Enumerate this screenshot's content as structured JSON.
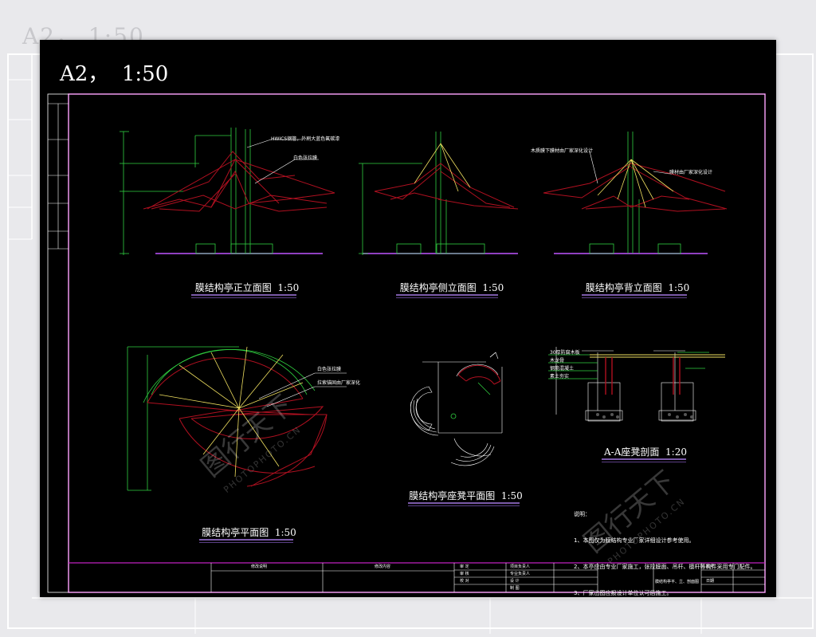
{
  "sheet_title": "A2，  1:50",
  "background_title": "A2，  1:50",
  "views": {
    "front_elevation": "膜结构亭正立面图  1:50",
    "side_elevation": "膜结构亭侧立面图  1:50",
    "back_elevation": "膜结构亭背立面图  1:50",
    "plan": "膜结构亭平面图  1:50",
    "seat_plan": "膜结构亭座凳平面图  1:50",
    "seat_section": "A-A座凳剖面  1:20"
  },
  "annotations": {
    "front_1": "HWICS钢管，外刷大蓝色氟碳漆",
    "front_2": "白色张拉膜",
    "back_1": "木质膜下膜材由厂家深化设计",
    "back_2": "膜材由厂家深化设计",
    "plan_1": "白色张拉膜",
    "plan_2": "拉索锚固由厂家深化",
    "section_labels": [
      "30厚防腐木板",
      "木龙骨",
      "钢筋混凝土",
      "素土夯实"
    ]
  },
  "notes": {
    "heading": "说明：",
    "items": [
      "1、本图仅为膜结构专业厂家详细设计参考使用。",
      "2、本亭应由专业厂家施工，张拉膜面、吊杆、檩杆等构件采用专门配件。",
      "3、厂家出图应报设计单位认可后施工。"
    ]
  },
  "title_block": {
    "left_cells": [
      "修改说明",
      "修改内容"
    ],
    "mid_cells": [
      "审 定",
      "项目负责人",
      "审 核",
      "校 对",
      "专业负责人",
      "设 计",
      "制 图"
    ],
    "right_title": "膜结构亭平、立、剖面图",
    "drawing_no_label": "图号",
    "date_label": "日期"
  },
  "watermark": {
    "cn": "图行天下",
    "en": "PHOTOPHOTO.CN"
  },
  "colors": {
    "frame_bg": "#000000",
    "border_magenta": "#c020c0",
    "membrane_red": "#b01020",
    "structure_green": "#30d040",
    "cable_yellow": "#f0e060",
    "ground_purple": "#9040c0"
  }
}
